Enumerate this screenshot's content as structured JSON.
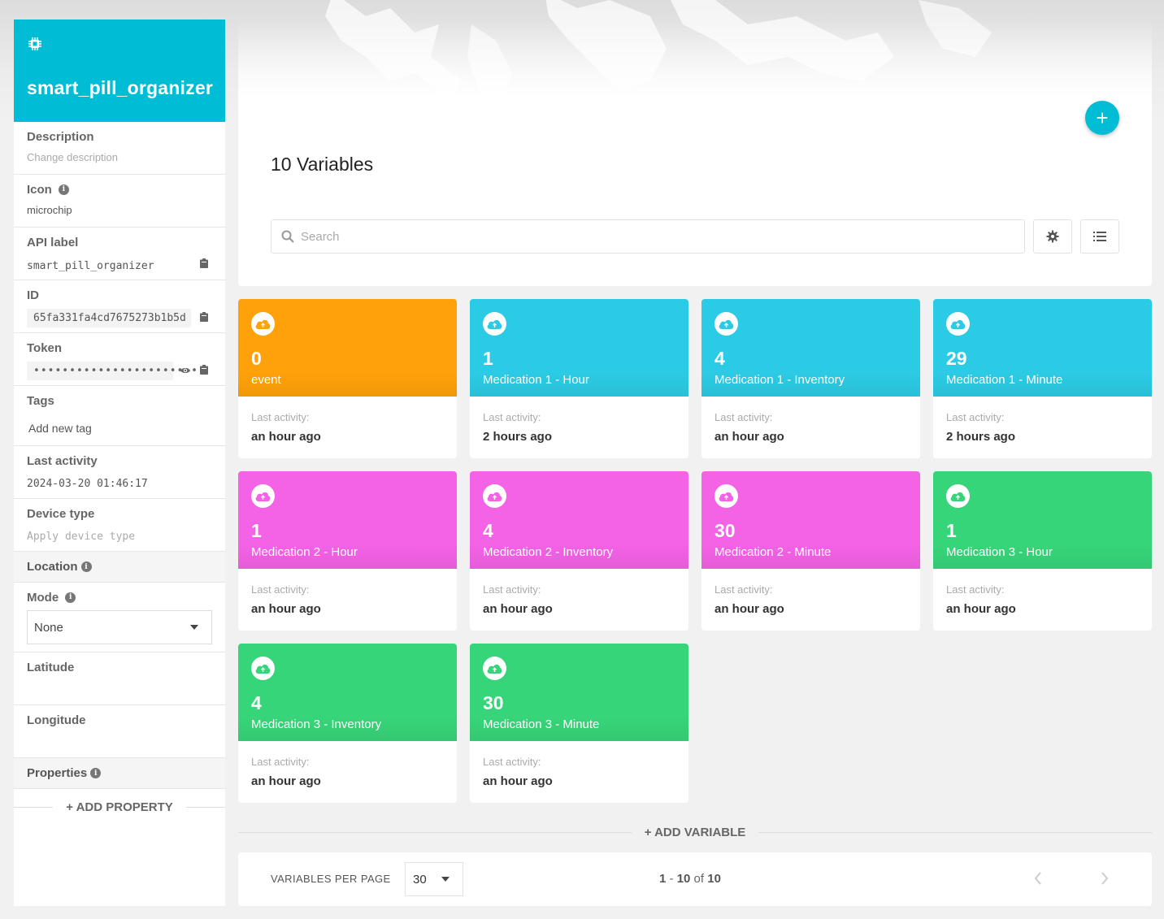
{
  "device": {
    "name": "smart_pill_organizer",
    "description_label": "Description",
    "description_value": "Change description",
    "icon_label": "Icon",
    "icon_value": "microchip",
    "api_label": "API label",
    "api_value": "smart_pill_organizer",
    "id_label": "ID",
    "id_value": "65fa331fa4cd7675273b1b5d",
    "token_label": "Token",
    "token_value": "••••••••••••••••••••••••",
    "tags_label": "Tags",
    "tags_placeholder": "Add new tag",
    "last_activity_label": "Last activity",
    "last_activity_value": "2024-03-20 01:46:17",
    "device_type_label": "Device type",
    "device_type_value": "Apply device type",
    "location_label": "Location",
    "mode_label": "Mode",
    "mode_value": "None",
    "latitude_label": "Latitude",
    "longitude_label": "Longitude",
    "properties_label": "Properties",
    "add_property": "+ ADD PROPERTY"
  },
  "main": {
    "variable_count_title": "10 Variables",
    "search_placeholder": "Search",
    "add_variable": "+ ADD VARIABLE",
    "last_activity_label": "Last activity:"
  },
  "variables": [
    {
      "value": "0",
      "name": "event",
      "ago": "an hour ago",
      "color": "#ffa10a"
    },
    {
      "value": "1",
      "name": "Medication 1 - Hour",
      "ago": "2 hours ago",
      "color": "#2ccbe5"
    },
    {
      "value": "4",
      "name": "Medication 1 - Inventory",
      "ago": "an hour ago",
      "color": "#2ccbe5"
    },
    {
      "value": "29",
      "name": "Medication 1 - Minute",
      "ago": "2 hours ago",
      "color": "#2ccbe5"
    },
    {
      "value": "1",
      "name": "Medication 2 - Hour",
      "ago": "an hour ago",
      "color": "#f462e6"
    },
    {
      "value": "4",
      "name": "Medication 2 - Inventory",
      "ago": "an hour ago",
      "color": "#f462e6"
    },
    {
      "value": "30",
      "name": "Medication 2 - Minute",
      "ago": "an hour ago",
      "color": "#f462e6"
    },
    {
      "value": "1",
      "name": "Medication 3 - Hour",
      "ago": "an hour ago",
      "color": "#37d579"
    },
    {
      "value": "4",
      "name": "Medication 3 - Inventory",
      "ago": "an hour ago",
      "color": "#37d579"
    },
    {
      "value": "30",
      "name": "Medication 3 - Minute",
      "ago": "an hour ago",
      "color": "#37d579"
    }
  ],
  "pager": {
    "per_page_label": "VARIABLES PER PAGE",
    "per_page_value": "30",
    "range_start": "1",
    "range_end": "10",
    "range_of": "of",
    "total": "10"
  },
  "colors": {
    "accent": "#00bcd4"
  },
  "icons": [
    "microchip-icon",
    "info-icon",
    "clipboard-icon",
    "eye-icon",
    "search-icon",
    "gear-icon",
    "list-icon",
    "cloud-upload-icon",
    "chevron-left-icon",
    "chevron-right-icon",
    "plus-icon"
  ]
}
